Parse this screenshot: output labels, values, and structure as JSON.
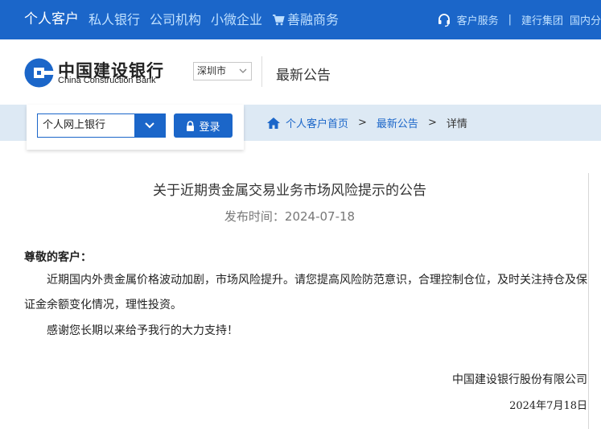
{
  "topnav": {
    "items": [
      {
        "label": "个人客户"
      },
      {
        "label": "私人银行"
      },
      {
        "label": "公司机构"
      },
      {
        "label": "小微企业"
      },
      {
        "label": "善融商务",
        "icon": "cart-icon"
      }
    ],
    "customer_service": "客户服务",
    "separator": "|",
    "group": "建行集团",
    "internal": "国内分"
  },
  "header": {
    "logo_cn": "中国建设银行",
    "logo_en": "China Construction Bank",
    "city": "深圳市",
    "title": "最新公告"
  },
  "login": {
    "bank_select": "个人网上银行",
    "login_label": "登录"
  },
  "breadcrumb": {
    "home": "个人客户首页",
    "sep": ">",
    "section": "最新公告",
    "current": "详情"
  },
  "article": {
    "title": "关于近期贵金属交易业务市场风险提示的公告",
    "publish": "发布时间：2024-07-18",
    "salutation": "尊敬的客户：",
    "paragraph": "近期国内外贵金属价格波动加剧，市场风险提升。请您提高风险防范意识，合理控制仓位，及时关注持仓及保证金余额变化情况，理性投资。",
    "thanks": "感谢您长期以来给予我行的大力支持！",
    "company": "中国建设银行股份有限公司",
    "date": "2024年7月18日"
  },
  "colors": {
    "brand_blue": "#1b66c9",
    "band": "#dde9f4"
  }
}
